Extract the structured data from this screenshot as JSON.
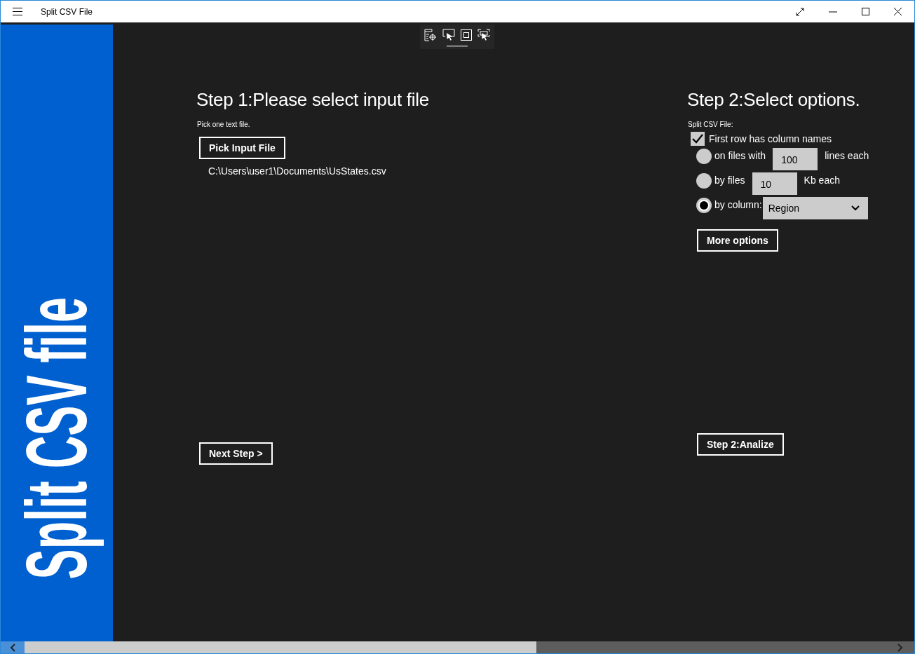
{
  "window": {
    "title": "Split CSV File"
  },
  "sidebar": {
    "title": "Split CSV file"
  },
  "step1": {
    "heading": "Step 1:Please select input file",
    "hint": "Pick one text file.",
    "pick_button": "Pick Input File",
    "file_path": "C:\\Users\\user1\\Documents\\UsStates.csv",
    "next_button": "Next Step >"
  },
  "step2": {
    "heading": "Step 2:Select options.",
    "label": "Split CSV File:",
    "first_row": {
      "label": "First row has column names",
      "checked": true
    },
    "options": [
      {
        "kind": "textbox",
        "label": "on files with",
        "value": "100",
        "suffix": "lines each",
        "selected": false
      },
      {
        "kind": "textbox",
        "label": "by files",
        "value": "10",
        "suffix": "Kb each",
        "selected": false
      },
      {
        "kind": "dropdown",
        "label": "by column:",
        "value": "Region",
        "selected": true
      }
    ],
    "more_button": "More options",
    "analyze_button": "Step 2:Analize"
  }
}
